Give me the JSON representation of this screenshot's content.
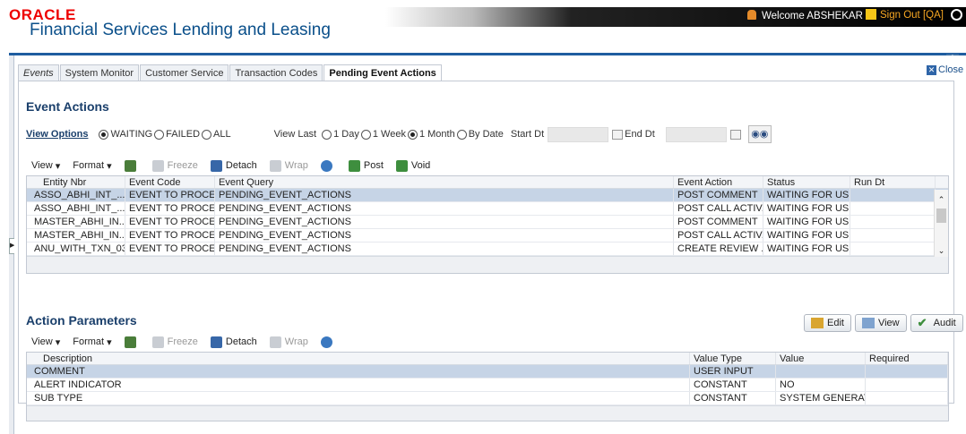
{
  "header": {
    "brand": "ORACLE",
    "product": "Financial Services Lending and Leasing",
    "welcome": "Welcome ABSHEKAR",
    "signout": "Sign Out [QA]"
  },
  "tabs": [
    "Events",
    "System Monitor",
    "Customer Service",
    "Transaction Codes",
    "Pending Event Actions"
  ],
  "close_label": "Close",
  "event_actions": {
    "title": "Event Actions",
    "view_options_label": "View Options",
    "status_options": [
      "WAITING",
      "FAILED",
      "ALL"
    ],
    "view_last_label": "View Last",
    "period_options": [
      "1 Day",
      "1 Week",
      "1 Month",
      "By Date"
    ],
    "start_dt_label": "Start Dt",
    "end_dt_label": "End Dt",
    "toolbar": {
      "view": "View",
      "format": "Format",
      "freeze": "Freeze",
      "detach": "Detach",
      "wrap": "Wrap",
      "post": "Post",
      "void": "Void"
    },
    "columns": [
      "Entity Nbr",
      "Event Code",
      "Event Query",
      "Event Action",
      "Status",
      "Run Dt"
    ],
    "rows": [
      [
        "ASSO_ABHI_INT_...",
        "EVENT TO PROCE...",
        "PENDING_EVENT_ACTIONS",
        "POST COMMENT",
        "WAITING FOR US...",
        ""
      ],
      [
        "ASSO_ABHI_INT_...",
        "EVENT TO PROCE...",
        "PENDING_EVENT_ACTIONS",
        "POST CALL ACTIV...",
        "WAITING FOR US...",
        ""
      ],
      [
        "MASTER_ABHI_IN...",
        "EVENT TO PROCE...",
        "PENDING_EVENT_ACTIONS",
        "POST COMMENT",
        "WAITING FOR US...",
        ""
      ],
      [
        "MASTER_ABHI_IN...",
        "EVENT TO PROCE...",
        "PENDING_EVENT_ACTIONS",
        "POST CALL ACTIV...",
        "WAITING FOR US...",
        ""
      ],
      [
        "ANU_WITH_TXN_03",
        "EVENT TO PROCE...",
        "PENDING_EVENT_ACTIONS",
        "CREATE REVIEW ...",
        "WAITING FOR US...",
        ""
      ]
    ]
  },
  "action_parameters": {
    "title": "Action Parameters",
    "buttons": {
      "edit": "Edit",
      "view": "View",
      "audit": "Audit"
    },
    "toolbar": {
      "view": "View",
      "format": "Format",
      "freeze": "Freeze",
      "detach": "Detach",
      "wrap": "Wrap"
    },
    "columns": [
      "Description",
      "Value Type",
      "Value",
      "Required"
    ],
    "rows": [
      [
        "COMMENT",
        "USER INPUT",
        "",
        ""
      ],
      [
        "ALERT INDICATOR",
        "CONSTANT",
        "NO",
        ""
      ],
      [
        "SUB TYPE",
        "CONSTANT",
        "SYSTEM GENERAT...",
        ""
      ]
    ]
  }
}
